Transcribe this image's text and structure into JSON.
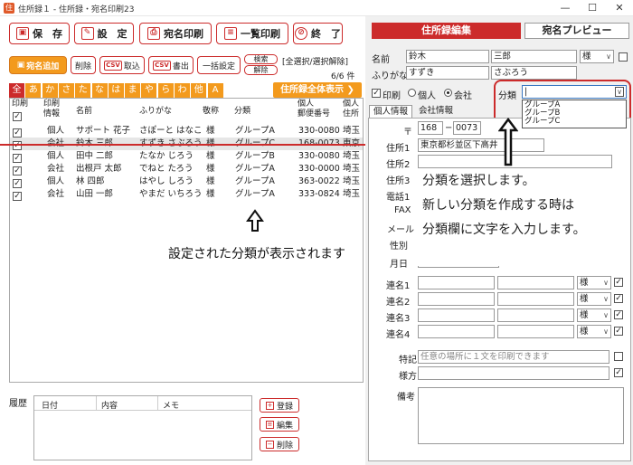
{
  "window": {
    "title": "住所録１ - 住所録・宛名印刷23",
    "app_icon": "住",
    "min": "—",
    "max": "☐",
    "close": "✕"
  },
  "toolbar": {
    "save": "保　存",
    "settings": "設　定",
    "print_address": "宛名印刷",
    "print_list": "一覧印刷",
    "exit": "終　了"
  },
  "subtoolbar": {
    "add": "宛名追加",
    "delete": "削除",
    "csv_import": "取込",
    "csv_export": "書出",
    "csv_tag": "CSV",
    "bulk_set": "一括設定",
    "search": "検索",
    "cancel": "解除",
    "select_all_links": "[全選択/選択解除]",
    "count": "6/6 件"
  },
  "kana_tabs": [
    "全",
    "あ",
    "か",
    "さ",
    "た",
    "な",
    "は",
    "ま",
    "や",
    "ら",
    "わ",
    "他",
    "A"
  ],
  "show_all": "住所録全体表示 ❯",
  "list": {
    "headers": {
      "print": "印刷",
      "print_info": "印刷\n情報",
      "name": "名前",
      "furigana": "ふりがな",
      "title": "敬称",
      "class": "分類",
      "zip": "個人\n郵便番号",
      "addr": "個人\n住所"
    },
    "rows": [
      {
        "info": "個人",
        "name": "サポート 花子",
        "furi": "さぽーと はなこ",
        "title": "様",
        "class": "グループA",
        "zip": "330-0080",
        "addr": "埼玉"
      },
      {
        "info": "会社",
        "name": "鈴木 三郎",
        "furi": "すずき さぶろう",
        "title": "様",
        "class": "グループC",
        "zip": "168-0073",
        "addr": "東京"
      },
      {
        "info": "個人",
        "name": "田中 二郎",
        "furi": "たなか じろう",
        "title": "様",
        "class": "グループB",
        "zip": "330-0080",
        "addr": "埼玉"
      },
      {
        "info": "会社",
        "name": "出根戸 太郎",
        "furi": "でねと たろう",
        "title": "様",
        "class": "グループA",
        "zip": "330-0000",
        "addr": "埼玉"
      },
      {
        "info": "個人",
        "name": "林 四郎",
        "furi": "はやし しろう",
        "title": "様",
        "class": "グループA",
        "zip": "363-0022",
        "addr": "埼玉"
      },
      {
        "info": "会社",
        "name": "山田 一郎",
        "furi": "やまだ いちろう",
        "title": "様",
        "class": "グループA",
        "zip": "333-0824",
        "addr": "埼玉"
      }
    ]
  },
  "note_left": "設定された分類が表示されます",
  "history": {
    "label": "履歴",
    "cols": [
      "日付",
      "内容",
      "メモ"
    ],
    "register": "登録",
    "edit": "編集",
    "delete": "削除"
  },
  "right": {
    "tab_edit": "住所録編集",
    "tab_preview": "宛名プレビュー",
    "name_label": "名前",
    "last": "鈴木",
    "first": "三郎",
    "title": "様",
    "furi_label": "ふりがな",
    "furi_last": "すずき",
    "furi_first": "さぶろう",
    "print_label": "印刷",
    "personal": "個人",
    "company": "会社",
    "class_label": "分類",
    "class_options": [
      "グループA",
      "グループB",
      "グループC"
    ],
    "info_tab1": "個人情報",
    "info_tab2": "会社情報",
    "zip_label": "〒",
    "zip1": "168",
    "zip2": "0073",
    "dash": "−",
    "addr1_label": "住所1",
    "addr1": "東京都杉並区下高井",
    "addr2_label": "住所2",
    "addr3_label": "住所3",
    "tel_label": "電話1",
    "fax_label": "FAX",
    "mail_label": "メール",
    "gender_label": "性別",
    "birth_label": "月日",
    "ren1": "連名1",
    "ren2": "連名2",
    "ren3": "連名3",
    "ren4": "連名4",
    "sama": "様",
    "tokki_label": "特記",
    "tokki_placeholder": "任意の場所に１文を印刷できます",
    "samakata_label": "様方",
    "biko_label": "備考"
  },
  "balloon": {
    "line1": "分類を選択します。",
    "line2": "新しい分類を作成する時は",
    "line3": "分類欄に文字を入力します。"
  }
}
